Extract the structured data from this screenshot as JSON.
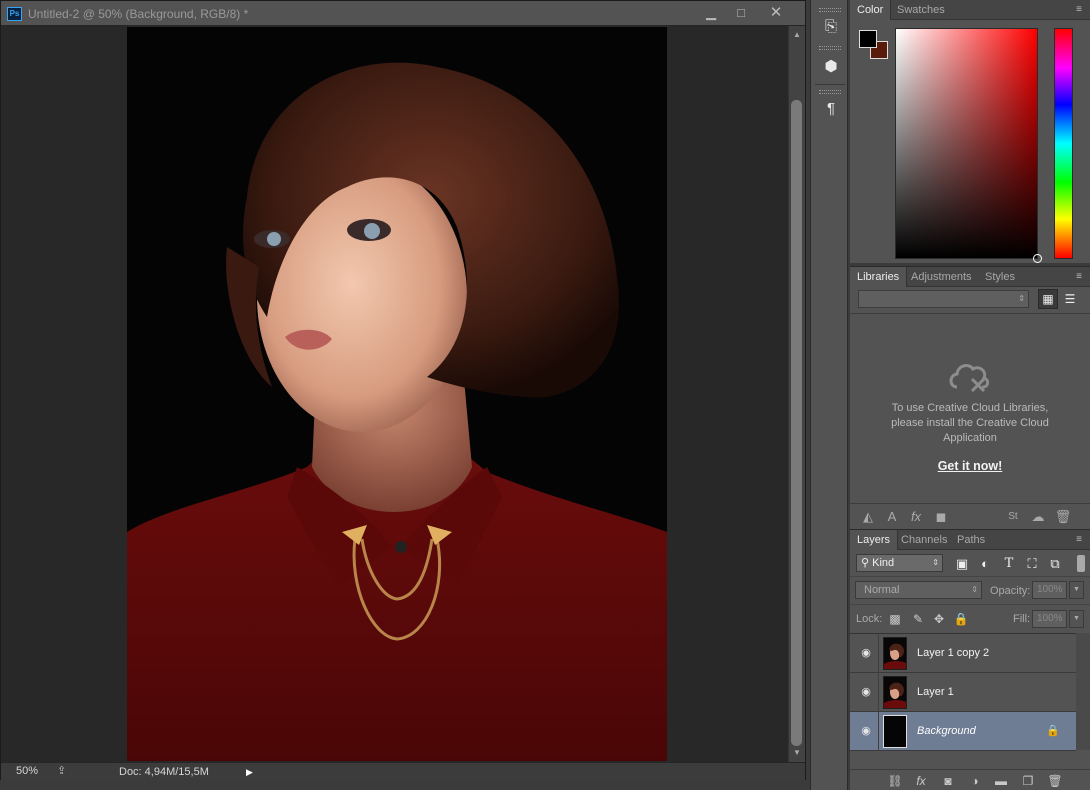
{
  "document": {
    "badge": "Ps",
    "title": "Untitled-2 @ 50% (Background, RGB/8) *",
    "window_buttons": {
      "minimize": "▁",
      "maximize": "□",
      "close": "✕"
    },
    "zoom": "50%",
    "doc_size": "Doc: 4,94M/15,5M"
  },
  "tools": [
    "history-tool-icon",
    "3d-cube-tool-icon",
    "paragraph-tool-icon"
  ],
  "color_panel": {
    "tabs": [
      "Color",
      "Swatches"
    ],
    "active_tab": "Color",
    "foreground_color": "#000000",
    "background_color": "#5a1b0b"
  },
  "libraries_panel": {
    "tabs": [
      "Libraries",
      "Adjustments",
      "Styles"
    ],
    "active_tab": "Libraries",
    "message": "To use Creative Cloud Libraries, please install the Creative Cloud Application",
    "cta": "Get it now!"
  },
  "layers_panel": {
    "tabs": [
      "Layers",
      "Channels",
      "Paths"
    ],
    "active_tab": "Layers",
    "filter_kind": "Kind",
    "blend_mode": "Normal",
    "opacity_label": "Opacity:",
    "opacity_value": "100%",
    "lock_label": "Lock:",
    "fill_label": "Fill:",
    "fill_value": "100%",
    "layers": [
      {
        "name": "Layer 1 copy 2",
        "visible": true,
        "selected": false,
        "locked": false
      },
      {
        "name": "Layer 1",
        "visible": true,
        "selected": false,
        "locked": false
      },
      {
        "name": "Background",
        "visible": true,
        "selected": true,
        "locked": true
      }
    ]
  },
  "colors": {
    "selection": "#6e7c94",
    "panel_bg": "#535353",
    "accent_badge": "#34a6f4"
  }
}
